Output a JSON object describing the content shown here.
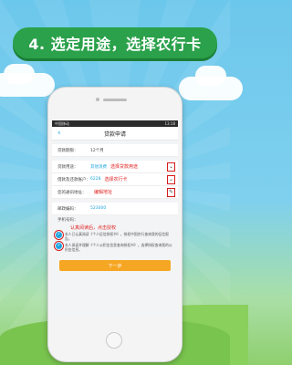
{
  "banner": {
    "title": "4. 选定用途，选择农行卡"
  },
  "app": {
    "status_left": "中国移动",
    "status_right": "13:18",
    "nav_title": "贷款申请",
    "back_icon": "chevron-left-icon"
  },
  "form": {
    "rows": [
      {
        "label": "贷款期限：",
        "value": "12个月",
        "hint": ""
      },
      {
        "label": "贷款用途：",
        "value": "其他消费",
        "hint": "选择贷款用途"
      },
      {
        "label": "借款及还款账户：",
        "value": "6228",
        "hint": "选择农行卡"
      },
      {
        "label": "您的通讯地址：",
        "value": "",
        "hint": "编辑地址"
      },
      {
        "label": "邮政编码：",
        "value": "523000",
        "hint": ""
      }
    ],
    "phone_label": "手机号码：",
    "agree_hint": "认真阅读后，点击授权",
    "agreements": [
      "本人已认真阅读《个人征信授权书》，授权中国农行查询我的征信报告。",
      "本人阅读并理解《个人公积金信息查询授权书》，选择授权查询我的公积金信息。"
    ],
    "submit_label": "下一步"
  }
}
